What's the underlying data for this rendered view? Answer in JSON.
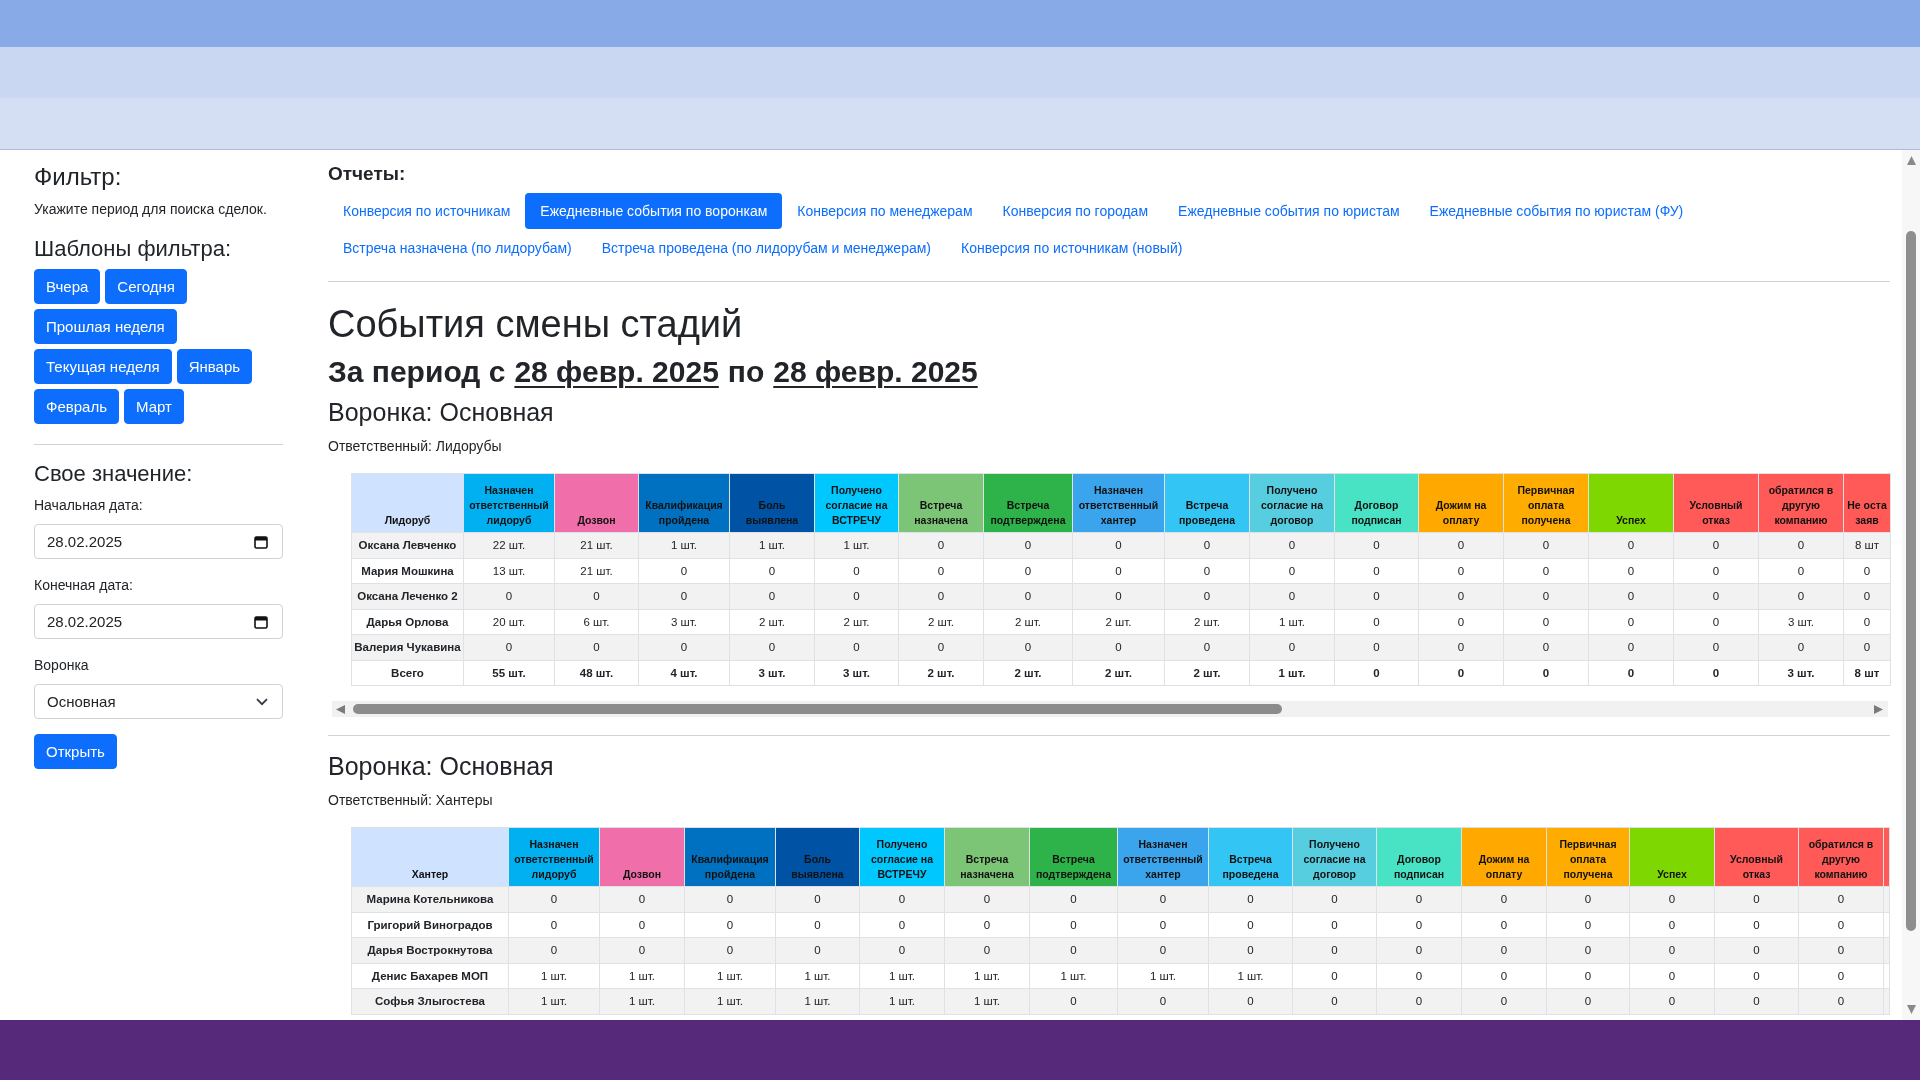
{
  "filter": {
    "title": "Фильтр:",
    "hint": "Укажите период для поиска сделок.",
    "templates_title": "Шаблоны фильтра:",
    "templates": [
      "Вчера",
      "Сегодня",
      "Прошлая неделя",
      "Текущая неделя",
      "Январь",
      "Февраль",
      "Март"
    ],
    "custom_title": "Свое значение:",
    "fields": [
      {
        "kind": "date",
        "label": "Начальная дата:",
        "value": "28.02.2025"
      },
      {
        "kind": "date",
        "label": "Конечная дата:",
        "value": "28.02.2025"
      },
      {
        "kind": "select",
        "label": "Воронка",
        "value": "Основная"
      }
    ],
    "submit": "Открыть"
  },
  "reports": {
    "title": "Отчеты:",
    "tabs": [
      {
        "label": "Конверсия по источникам",
        "selected": false
      },
      {
        "label": "Ежедневные события по воронкам",
        "selected": true
      },
      {
        "label": "Конверсия по менеджерам",
        "selected": false
      },
      {
        "label": "Конверсия по городам",
        "selected": false
      },
      {
        "label": "Ежедневные события по юристам",
        "selected": false
      },
      {
        "label": "Ежедневные события по юристам (ФУ)",
        "selected": false
      },
      {
        "label": "Встреча назначена (по лидорубам)",
        "selected": false
      },
      {
        "label": "Встреча проведена (по лидорубам и менеджерам)",
        "selected": false
      },
      {
        "label": "Конверсия по источникам (новый)",
        "selected": false
      }
    ]
  },
  "report": {
    "title": "События смены стадий",
    "period": {
      "prefix": "За период с",
      "from": "28 февр. 2025",
      "joiner": "по",
      "to": "28 февр. 2025"
    },
    "sections": [
      {
        "funnel": "Воронка: Основная",
        "responsible": "Ответственный: Лидорубы",
        "horizontal_scrollbar": true,
        "columns": [
          {
            "label": "Лидоруб",
            "color": "#cfe2ff"
          },
          {
            "label": "Назначен ответственный лидоруб",
            "color": "#00b0f0"
          },
          {
            "label": "Дозвон",
            "color": "#f06eaa"
          },
          {
            "label": "Квалификация пройдена",
            "color": "#0070c0"
          },
          {
            "label": "Боль выявлена",
            "color": "#0052a5"
          },
          {
            "label": "Получено согласие на ВСТРЕЧУ",
            "color": "#00c8ff"
          },
          {
            "label": "Встреча назначена",
            "color": "#7dc576"
          },
          {
            "label": "Встреча подтверждена",
            "color": "#2db34a"
          },
          {
            "label": "Назначен ответственный хантер",
            "color": "#3aa5ec"
          },
          {
            "label": "Встреча проведена",
            "color": "#33c5f3"
          },
          {
            "label": "Получено согласие на договор",
            "color": "#56cee0"
          },
          {
            "label": "Договор подписан",
            "color": "#47e3c4"
          },
          {
            "label": "Дожим на оплату",
            "color": "#ffa800"
          },
          {
            "label": "Первичная оплата получена",
            "color": "#ffac00"
          },
          {
            "label": "Успех",
            "color": "#7ed700"
          },
          {
            "label": "Условный отказ",
            "color": "#ff5a57"
          },
          {
            "label": "обратился в другую компанию",
            "color": "#ff5a57"
          },
          {
            "label": "Не оста заяв",
            "color": "#ff5a57"
          }
        ],
        "rows": [
          {
            "kind": "person",
            "cells": [
              "Оксана Левченко",
              "22 шт.",
              "21 шт.",
              "1 шт.",
              "1 шт.",
              "1 шт.",
              "0",
              "0",
              "0",
              "0",
              "0",
              "0",
              "0",
              "0",
              "0",
              "0",
              "0",
              "8 шт"
            ]
          },
          {
            "kind": "person",
            "cells": [
              "Мария Мошкина",
              "13 шт.",
              "21 шт.",
              "0",
              "0",
              "0",
              "0",
              "0",
              "0",
              "0",
              "0",
              "0",
              "0",
              "0",
              "0",
              "0",
              "0",
              "0"
            ]
          },
          {
            "kind": "person",
            "cells": [
              "Оксана Леченко 2",
              "0",
              "0",
              "0",
              "0",
              "0",
              "0",
              "0",
              "0",
              "0",
              "0",
              "0",
              "0",
              "0",
              "0",
              "0",
              "0",
              "0"
            ]
          },
          {
            "kind": "person",
            "cells": [
              "Дарья Орлова",
              "20 шт.",
              "6 шт.",
              "3 шт.",
              "2 шт.",
              "2 шт.",
              "2 шт.",
              "2 шт.",
              "2 шт.",
              "2 шт.",
              "1 шт.",
              "0",
              "0",
              "0",
              "0",
              "0",
              "3 шт.",
              "0"
            ]
          },
          {
            "kind": "person",
            "cells": [
              "Валерия Чукавина",
              "0",
              "0",
              "0",
              "0",
              "0",
              "0",
              "0",
              "0",
              "0",
              "0",
              "0",
              "0",
              "0",
              "0",
              "0",
              "0",
              "0"
            ]
          },
          {
            "kind": "total",
            "cells": [
              "Всего",
              "55 шт.",
              "48 шт.",
              "4 шт.",
              "3 шт.",
              "3 шт.",
              "2 шт.",
              "2 шт.",
              "2 шт.",
              "2 шт.",
              "1 шт.",
              "0",
              "0",
              "0",
              "0",
              "0",
              "3 шт.",
              "8 шт"
            ]
          }
        ]
      },
      {
        "funnel": "Воронка: Основная",
        "responsible": "Ответственный: Хантеры",
        "columns": [
          {
            "label": "Хантер",
            "color": "#cfe2ff"
          },
          {
            "label": "Назначен ответственный лидоруб",
            "color": "#00b0f0"
          },
          {
            "label": "Дозвон",
            "color": "#f06eaa"
          },
          {
            "label": "Квалификация пройдена",
            "color": "#0070c0"
          },
          {
            "label": "Боль выявлена",
            "color": "#0052a5"
          },
          {
            "label": "Получено согласие на ВСТРЕЧУ",
            "color": "#00c8ff"
          },
          {
            "label": "Встреча назначена",
            "color": "#7dc576"
          },
          {
            "label": "Встреча подтверждена",
            "color": "#2db34a"
          },
          {
            "label": "Назначен ответственный хантер",
            "color": "#3aa5ec"
          },
          {
            "label": "Встреча проведена",
            "color": "#33c5f3"
          },
          {
            "label": "Получено согласие на договор",
            "color": "#56cee0"
          },
          {
            "label": "Договор подписан",
            "color": "#47e3c4"
          },
          {
            "label": "Дожим на оплату",
            "color": "#ffa800"
          },
          {
            "label": "Первичная оплата получена",
            "color": "#ffac00"
          },
          {
            "label": "Успех",
            "color": "#7ed700"
          },
          {
            "label": "Условный отказ",
            "color": "#ff5a57"
          },
          {
            "label": "обратился в другую компанию",
            "color": "#ff5a57"
          },
          {
            "color": "#ff5a57"
          }
        ],
        "rows": [
          {
            "kind": "person",
            "cells": [
              "Марина Котельникова",
              "0",
              "0",
              "0",
              "0",
              "0",
              "0",
              "0",
              "0",
              "0",
              "0",
              "0",
              "0",
              "0",
              "0",
              "0",
              "0"
            ]
          },
          {
            "kind": "person",
            "cells": [
              "Григорий Виноградов",
              "0",
              "0",
              "0",
              "0",
              "0",
              "0",
              "0",
              "0",
              "0",
              "0",
              "0",
              "0",
              "0",
              "0",
              "0",
              "0"
            ]
          },
          {
            "kind": "person",
            "cells": [
              "Дарья Вострокнутова",
              "0",
              "0",
              "0",
              "0",
              "0",
              "0",
              "0",
              "0",
              "0",
              "0",
              "0",
              "0",
              "0",
              "0",
              "0",
              "0"
            ]
          },
          {
            "kind": "person",
            "cells": [
              "Денис Бахарев МОП",
              "1 шт.",
              "1 шт.",
              "1 шт.",
              "1 шт.",
              "1 шт.",
              "1 шт.",
              "1 шт.",
              "1 шт.",
              "1 шт.",
              "0",
              "0",
              "0",
              "0",
              "0",
              "0",
              "0"
            ]
          },
          {
            "kind": "person",
            "cells": [
              "Софья Злыгостева",
              "1 шт.",
              "1 шт.",
              "1 шт.",
              "1 шт.",
              "1 шт.",
              "1 шт.",
              "0",
              "0",
              "0",
              "0",
              "0",
              "0",
              "0",
              "0",
              "0",
              "0"
            ]
          }
        ]
      }
    ]
  }
}
